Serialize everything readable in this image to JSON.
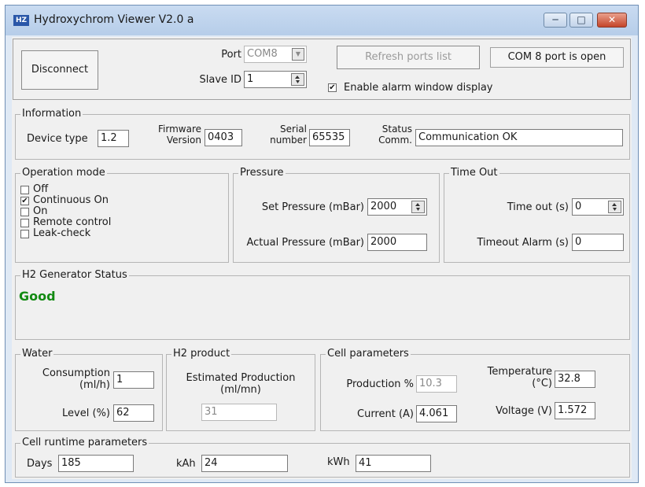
{
  "window": {
    "title": "Hydroxychrom Viewer V2.0 a",
    "app_icon": "HZ",
    "minimize": "─",
    "maximize": "□",
    "close": "✕"
  },
  "connection": {
    "disconnect_label": "Disconnect",
    "port_label": "Port",
    "port_value": "COM8",
    "slave_label": "Slave ID",
    "slave_value": "1",
    "refresh_label": "Refresh ports list",
    "port_status": "COM 8 port is open",
    "alarm_label": "Enable alarm window display",
    "alarm_checked": true
  },
  "information": {
    "title": "Information",
    "device_type_label": "Device type",
    "device_type_value": "1.2",
    "firmware_label_1": "Firmware",
    "firmware_label_2": "Version",
    "firmware_value": "0403",
    "serial_label_1": "Serial",
    "serial_label_2": "number",
    "serial_value": "65535",
    "status_label_1": "Status",
    "status_label_2": "Comm.",
    "status_value": "Communication OK"
  },
  "operation_mode": {
    "title": "Operation mode",
    "options": [
      {
        "label": "Off",
        "checked": false
      },
      {
        "label": "Continuous On",
        "checked": true
      },
      {
        "label": "On",
        "checked": false
      },
      {
        "label": "Remote control",
        "checked": false
      },
      {
        "label": "Leak-check",
        "checked": false
      }
    ]
  },
  "pressure": {
    "title": "Pressure",
    "set_label": "Set Pressure (mBar)",
    "set_value": "2000",
    "actual_label": "Actual Pressure (mBar)",
    "actual_value": "2000"
  },
  "timeout": {
    "title": "Time Out",
    "timeout_label": "Time out (s)",
    "timeout_value": "0",
    "alarm_label": "Timeout Alarm (s)",
    "alarm_value": "0"
  },
  "generator": {
    "title": "H2 Generator Status",
    "status": "Good",
    "status_color": "#128a12"
  },
  "water": {
    "title": "Water",
    "consumption_label_1": "Consumption",
    "consumption_label_2": "(ml/h)",
    "consumption_value": "1",
    "level_label": "Level (%)",
    "level_value": "62"
  },
  "h2_product": {
    "title": "H2 product",
    "estimated_label_1": "Estimated Production",
    "estimated_label_2": "(ml/mn)",
    "estimated_value": "31"
  },
  "cell_parameters": {
    "title": "Cell parameters",
    "production_label": "Production %",
    "production_value": "10.3",
    "current_label": "Current (A)",
    "current_value": "4.061",
    "temperature_label_1": "Temperature",
    "temperature_label_2": "(°C)",
    "temperature_value": "32.8",
    "voltage_label": "Voltage (V)",
    "voltage_value": "1.572"
  },
  "runtime": {
    "title": "Cell runtime parameters",
    "days_label": "Days",
    "days_value": "185",
    "kah_label": "kAh",
    "kah_value": "24",
    "kwh_label": "kWh",
    "kwh_value": "41"
  },
  "icons": {
    "spin": "spin-updown-icon",
    "check": "✔",
    "dropdown": "▼"
  }
}
